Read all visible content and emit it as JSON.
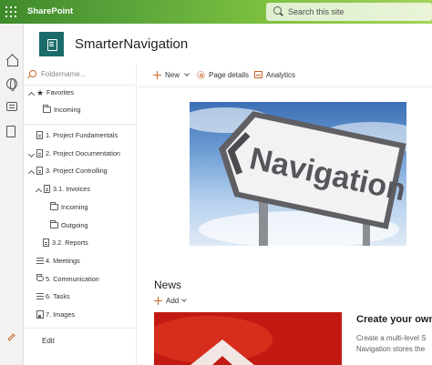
{
  "suite_bar": {
    "app_name": "SharePoint",
    "search_placeholder": "Search this site",
    "accent_color": "#5aa53b"
  },
  "app_bar": {
    "icons": [
      "home-icon",
      "globe-icon",
      "news-icon",
      "file-icon"
    ]
  },
  "site": {
    "title": "SmarterNavigation",
    "logo_color": "#1b6b6b"
  },
  "left_nav": {
    "filter_placeholder": "Foldername...",
    "items": [
      {
        "label": "Favorites",
        "icon": "star-icon",
        "expand": "expanded"
      },
      {
        "label": "Incoming",
        "icon": "folder-icon"
      },
      {
        "label": "1. Project Fundamentals",
        "icon": "page-icon"
      },
      {
        "label": "2. Project Documentation",
        "icon": "page-icon",
        "expand": "collapsed"
      },
      {
        "label": "3. Project Controlling",
        "icon": "page-icon",
        "expand": "expanded"
      },
      {
        "label": "3.1. Invoices",
        "icon": "page-icon",
        "expand": "expanded"
      },
      {
        "label": "Incoming",
        "icon": "folder-icon"
      },
      {
        "label": "Outgoing",
        "icon": "folder-icon"
      },
      {
        "label": "3.2. Reports",
        "icon": "page-icon"
      },
      {
        "label": "4. Meetings",
        "icon": "list-icon"
      },
      {
        "label": "5. Communication",
        "icon": "chat-icon"
      },
      {
        "label": "6. Tasks",
        "icon": "list-icon"
      },
      {
        "label": "7. Images",
        "icon": "image-icon"
      }
    ],
    "edit_label": "Edit"
  },
  "command_bar": {
    "new_label": "New",
    "page_details_label": "Page details",
    "analytics_label": "Analytics"
  },
  "hero": {
    "sign_text": "Navigation"
  },
  "news": {
    "title": "News",
    "add_label": "Add",
    "card_title": "Create your own",
    "card_text_line1": "Create a multi-level S",
    "card_text_line2": "Navigation stores the"
  }
}
